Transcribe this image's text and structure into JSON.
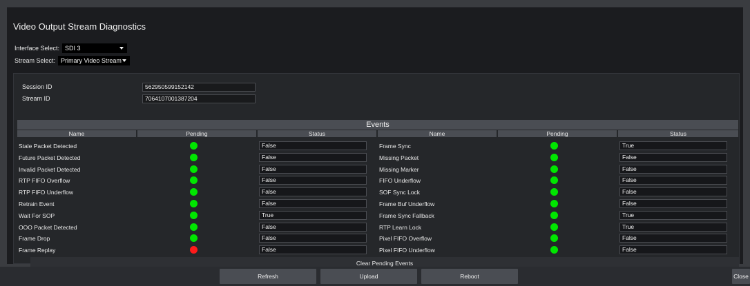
{
  "window": {
    "title": "Video Output Stream Diagnostics"
  },
  "interface_select": {
    "label": "Interface Select:",
    "value": "SDI 3"
  },
  "stream_select": {
    "label": "Stream Select:",
    "value": "Primary Video Stream"
  },
  "session": {
    "label": "Session ID",
    "value": "562950599152142"
  },
  "stream": {
    "label": "Stream ID",
    "value": "7064107001387204"
  },
  "events": {
    "title": "Events",
    "columns": [
      "Name",
      "Pending",
      "Status",
      "Name",
      "Pending",
      "Status"
    ],
    "status_colors": {
      "ok": "#00e600",
      "alert": "#ff1a1a"
    },
    "left": [
      {
        "name": "Stale Packet Detected",
        "pending": "ok",
        "status": "False"
      },
      {
        "name": "Future Packet Detected",
        "pending": "ok",
        "status": "False"
      },
      {
        "name": "Invalid Packet Detected",
        "pending": "ok",
        "status": "False"
      },
      {
        "name": "RTP FIFO Overflow",
        "pending": "ok",
        "status": "False"
      },
      {
        "name": "RTP FIFO Underflow",
        "pending": "ok",
        "status": "False"
      },
      {
        "name": "Retrain Event",
        "pending": "ok",
        "status": "False"
      },
      {
        "name": "Wait For SOP",
        "pending": "ok",
        "status": "True"
      },
      {
        "name": "OOO Packet Detected",
        "pending": "ok",
        "status": "False"
      },
      {
        "name": "Frame Drop",
        "pending": "ok",
        "status": "False"
      },
      {
        "name": "Frame Replay",
        "pending": "alert",
        "status": "False"
      }
    ],
    "right": [
      {
        "name": "Frame Sync",
        "pending": "ok",
        "status": "True"
      },
      {
        "name": "Missing Packet",
        "pending": "ok",
        "status": "False"
      },
      {
        "name": "Missing Marker",
        "pending": "ok",
        "status": "False"
      },
      {
        "name": "FIFO Underflow",
        "pending": "ok",
        "status": "False"
      },
      {
        "name": "SOF Sync Lock",
        "pending": "ok",
        "status": "False"
      },
      {
        "name": "Frame Buf Underflow",
        "pending": "ok",
        "status": "False"
      },
      {
        "name": "Frame Sync Fallback",
        "pending": "ok",
        "status": "True"
      },
      {
        "name": "RTP Learn Lock",
        "pending": "ok",
        "status": "True"
      },
      {
        "name": "Pixel FIFO Overflow",
        "pending": "ok",
        "status": "False"
      },
      {
        "name": "Pixel FIFO Underflow",
        "pending": "ok",
        "status": "False"
      }
    ],
    "clear_label": "Clear Pending Events"
  },
  "footer": {
    "refresh": "Refresh",
    "upload": "Upload",
    "reboot": "Reboot",
    "close": "Close"
  }
}
